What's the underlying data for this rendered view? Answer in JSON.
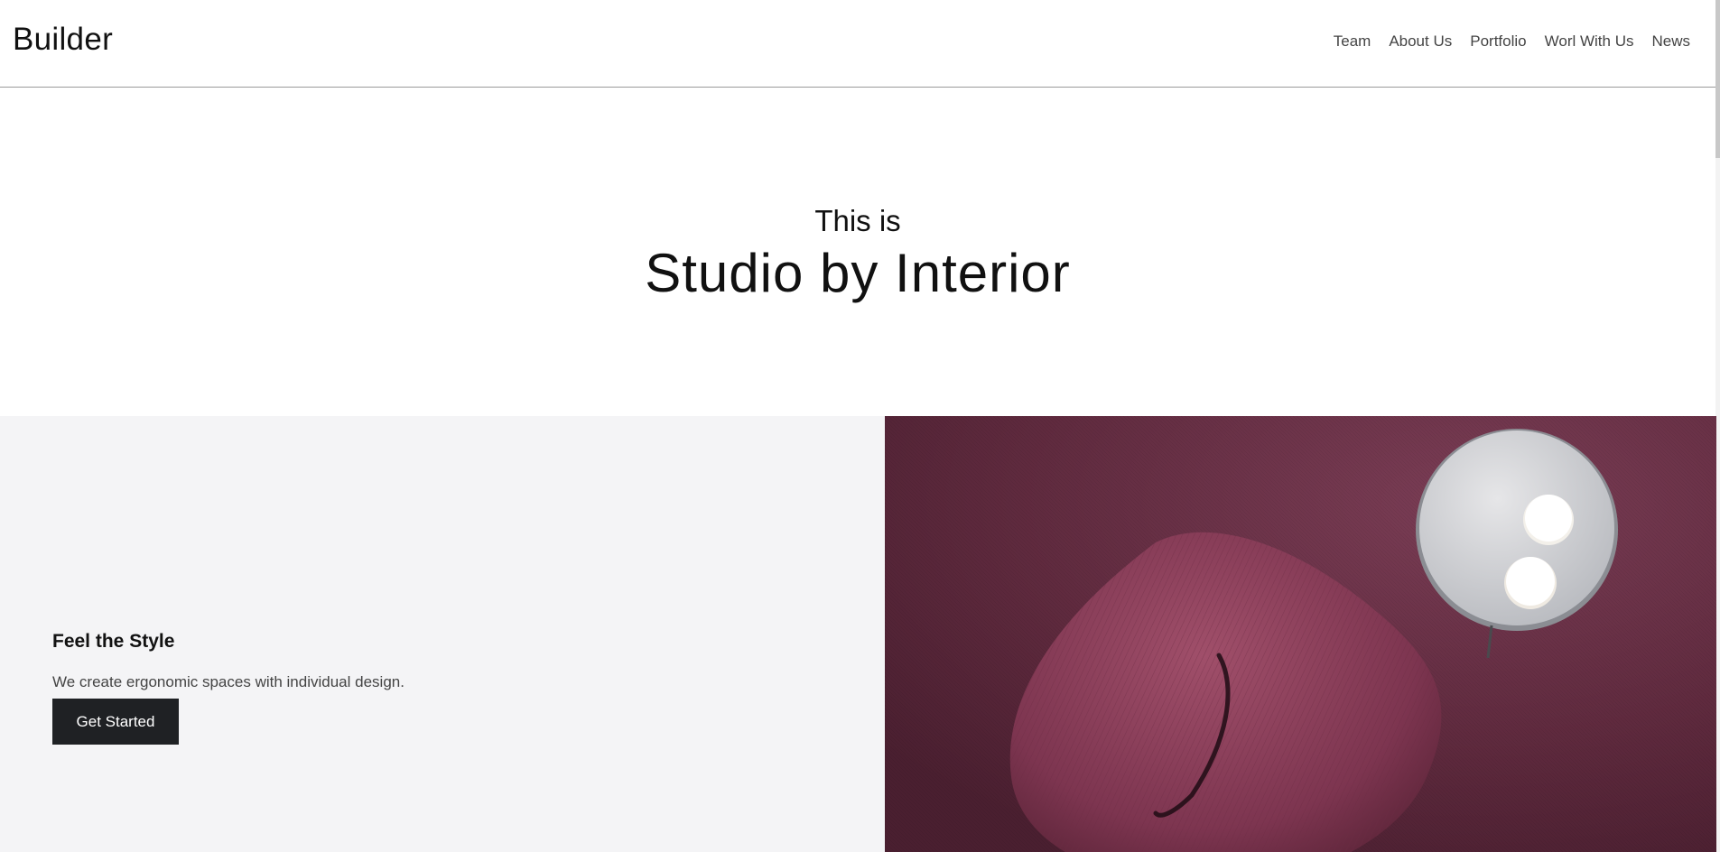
{
  "header": {
    "brand": "Builder",
    "nav": [
      "Team",
      "About Us",
      "Portfolio",
      "Worl With Us",
      "News"
    ]
  },
  "hero": {
    "pre": "This is",
    "title": "Studio by Interior"
  },
  "feature": {
    "title": "Feel the Style",
    "description": "We create ergonomic spaces with individual design.",
    "cta_label": "Get Started"
  },
  "colors": {
    "accent_dark": "#1f2124",
    "panel_bg": "#f4f4f6",
    "photo_tone": "#6a2f45"
  }
}
